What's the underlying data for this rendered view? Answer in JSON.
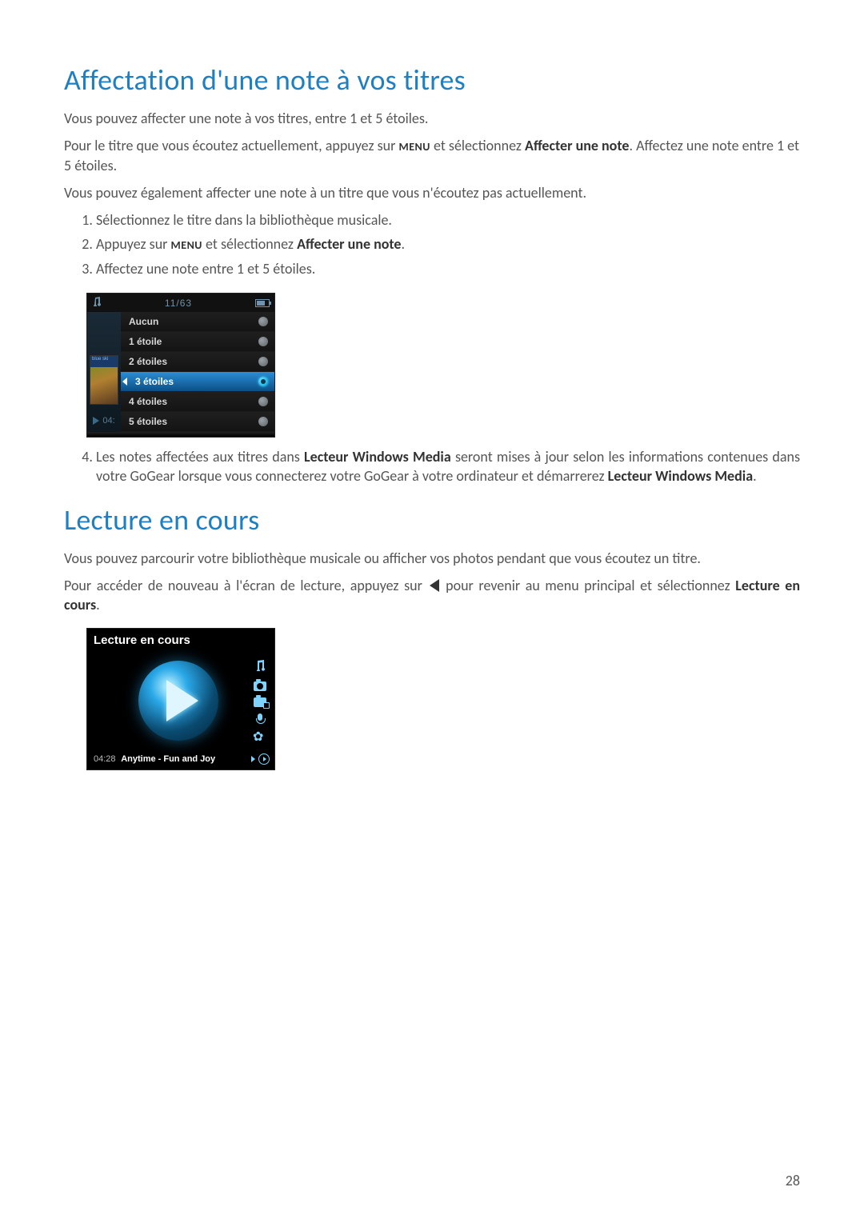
{
  "section1": {
    "title": "Affectation d'une note à vos titres",
    "p1": "Vous pouvez affecter une note à vos titres, entre 1 et 5 étoiles.",
    "p2a": "Pour le titre que vous écoutez actuellement, appuyez sur ",
    "p2_menu": "MENU",
    "p2b": " et sélectionnez ",
    "p2_bold": "Affecter une note",
    "p2c": ". Affectez une note entre 1 et 5 étoiles.",
    "p3": "Vous pouvez également affecter une note à un titre que vous n'écoutez pas actuellement.",
    "steps": [
      "Sélectionnez le titre dans la bibliothèque musicale.",
      "Appuyez sur MENU et sélectionnez Affecter une note.",
      "Affectez une note entre 1 et 5 étoiles."
    ],
    "step2_prefix": "Appuyez sur ",
    "step2_menu": "MENU",
    "step2_mid": " et sélectionnez ",
    "step2_bold": "Affecter une note",
    "step2_suffix": ".",
    "step4a": "Les notes affectées aux titres dans ",
    "step4_bold1": "Lecteur Windows Media",
    "step4b": " seront mises à jour selon les informations contenues dans votre GoGear lorsque vous connecterez votre GoGear à votre ordinateur et démarrerez ",
    "step4_bold2": "Lecteur Windows Media",
    "step4c": "."
  },
  "device1": {
    "counter": "11/63",
    "thumb_caption": "blue ski",
    "play_time": "04:",
    "rows": [
      {
        "label": "Aucun",
        "selected": false
      },
      {
        "label": "1 étoile",
        "selected": false
      },
      {
        "label": "2 étoiles",
        "selected": false
      },
      {
        "label": "3 étoiles",
        "selected": true
      },
      {
        "label": "4 étoiles",
        "selected": false
      },
      {
        "label": "5 étoiles",
        "selected": false
      }
    ]
  },
  "section2": {
    "title": "Lecture en cours",
    "p1": "Vous pouvez parcourir votre bibliothèque musicale ou afficher vos photos pendant que vous écoutez un titre.",
    "p2a": "Pour accéder de nouveau à l'écran de lecture, appuyez sur ",
    "p2b": " pour revenir au menu principal et sélectionnez ",
    "p2_bold": "Lecture en cours",
    "p2c": "."
  },
  "device2": {
    "title": "Lecture en cours",
    "time": "04:28",
    "track": "Anytime - Fun and Joy"
  },
  "page_number": "28"
}
